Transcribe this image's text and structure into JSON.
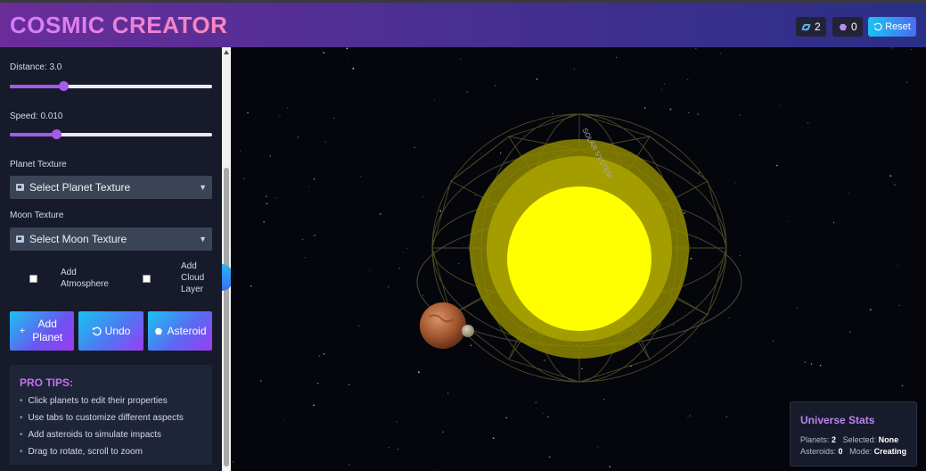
{
  "app": {
    "title": "COSMIC CREATOR"
  },
  "header": {
    "planet_count": "2",
    "asteroid_count": "0",
    "reset_label": "Reset"
  },
  "sidebar": {
    "distance_label": "Distance: 3.0",
    "distance_value": 3.0,
    "speed_label": "Speed: 0.010",
    "speed_value": 0.01,
    "planet_texture_label": "Planet Texture",
    "planet_texture_value": "Select Planet Texture",
    "moon_texture_label": "Moon Texture",
    "moon_texture_value": "Select Moon Texture",
    "add_atmosphere_label": "Add Atmosphere",
    "add_atmosphere_checked": false,
    "add_cloud_label": "Add Cloud Layer",
    "add_cloud_checked": false,
    "buttons": {
      "add_planet": "Add Planet",
      "undo": "Undo",
      "asteroid": "Asteroid"
    },
    "pro_tips": {
      "title": "PRO TIPS:",
      "items": [
        "Click planets to edit their properties",
        "Use tabs to customize different aspects",
        "Add asteroids to simulate impacts",
        "Drag to rotate, scroll to zoom"
      ]
    }
  },
  "scene": {
    "sun_label": "SOLAR SYSTEM",
    "colors": {
      "sun": "#ffff00",
      "sun_glow": "#a8a300",
      "mars": "#b5673f",
      "moon": "#b9ab8d",
      "wireframe": "#5b5a2e"
    }
  },
  "stats": {
    "title": "Universe Stats",
    "planets_label": "Planets:",
    "planets_value": "2",
    "selected_label": "Selected:",
    "selected_value": "None",
    "asteroids_label": "Asteroids:",
    "asteroids_value": "0",
    "mode_label": "Mode:",
    "mode_value": "Creating"
  },
  "colors": {
    "accent": "#a45be8",
    "button_gradient_start": "#19c3f0",
    "button_gradient_end": "#9b3cf0"
  }
}
